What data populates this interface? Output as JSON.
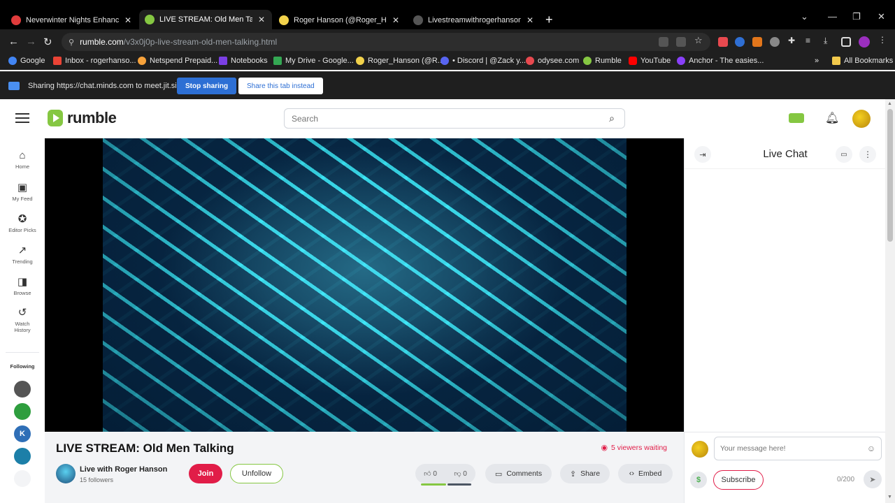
{
  "browser": {
    "tabs": [
      {
        "title": "Neverwinter Nights Enhanced Ed",
        "favicon_color": "#e03c3c"
      },
      {
        "title": "LIVE STREAM: Old Men Talking",
        "favicon_color": "#85c742"
      },
      {
        "title": "Roger Hanson (@Roger_Hanson",
        "favicon_color": "#f2d24b"
      },
      {
        "title": "Livestreamwithrogerhanson",
        "favicon_color": "#555555"
      }
    ],
    "close_glyph": "✕",
    "new_tab_glyph": "+",
    "url_host": "rumble.com",
    "url_path": "/v3x0j0p-live-stream-old-men-talking.html",
    "bookmarks": [
      {
        "label": "Google",
        "color": "#4285f4"
      },
      {
        "label": "Inbox - rogerhanso...",
        "color": "#ea4335"
      },
      {
        "label": "Netspend Prepaid...",
        "color": "#f7a23b"
      },
      {
        "label": "Notebooks",
        "color": "#7b3fe4"
      },
      {
        "label": "My Drive - Google...",
        "color": "#34a853"
      },
      {
        "label": "Roger_Hanson (@R...",
        "color": "#f2d24b"
      },
      {
        "label": "• Discord | @Zack y...",
        "color": "#5865f2"
      },
      {
        "label": "odysee.com",
        "color": "#e8494f"
      },
      {
        "label": "Rumble",
        "color": "#85c742"
      },
      {
        "label": "YouTube",
        "color": "#ff0000"
      },
      {
        "label": "Anchor - The easies...",
        "color": "#8940fa"
      }
    ],
    "bookmarks_overflow": "»",
    "all_bookmarks": "All Bookmarks",
    "sharing_text": "Sharing https://chat.minds.com to meet.jit.si",
    "stop_sharing": "Stop sharing",
    "share_this_tab": "Share this tab instead"
  },
  "rumble": {
    "logo": "rumble",
    "search_placeholder": "Search",
    "sidebar": [
      {
        "icon": "⌂",
        "label": "Home"
      },
      {
        "icon": "▣",
        "label": "My Feed"
      },
      {
        "icon": "✪",
        "label": "Editor Picks"
      },
      {
        "icon": "↗",
        "label": "Trending"
      },
      {
        "icon": "◨",
        "label": "Browse"
      },
      {
        "icon": "↺",
        "label": "Watch"
      }
    ],
    "watch_history_second_line": "History",
    "following_label": "Following",
    "following_avatar_colors": [
      "#555555",
      "#2e9e3e",
      "#2f6fb7",
      "#1c7fa8",
      "#f3f4f6"
    ],
    "video_title": "LIVE STREAM: Old Men Talking",
    "viewers_waiting": "5 viewers waiting",
    "channel_name": "Live with Roger Hanson",
    "followers": "15 followers",
    "join_label": "Join",
    "unfollow_label": "Unfollow",
    "likes": "0",
    "dislikes": "0",
    "comments_label": "Comments",
    "share_label": "Share",
    "embed_label": "Embed"
  },
  "chat": {
    "title": "Live Chat",
    "input_placeholder": "Your message here!",
    "subscribe_label": "Subscribe",
    "char_count": "0/200",
    "dollar_glyph": "$"
  }
}
